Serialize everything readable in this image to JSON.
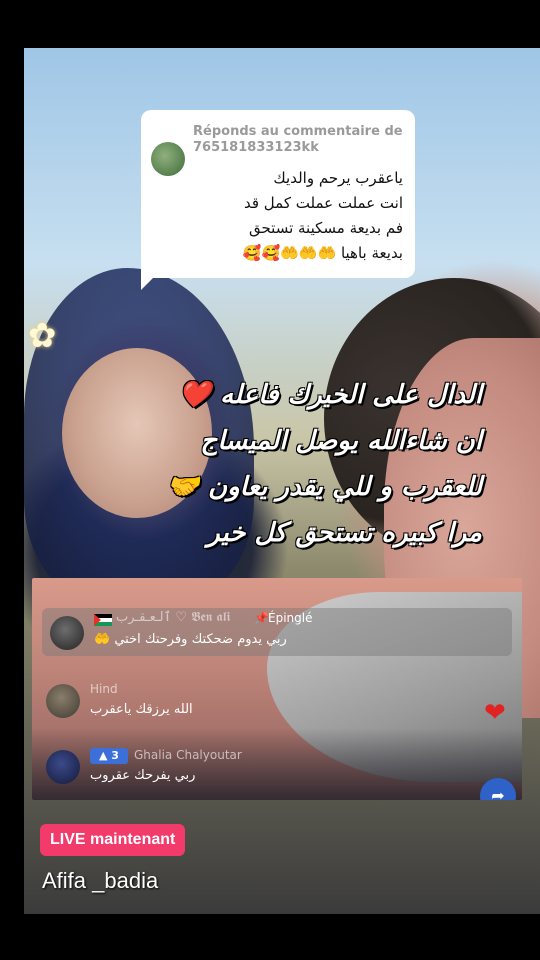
{
  "comment": {
    "reply_to": "Réponds au commentaire de 765181833123kk",
    "lines": [
      "ياعقرب يرحم والديك",
      "انت عملت عملت كمل قد",
      "فم بديعة مسكينة تستحق",
      "بديعة باهيا 🤲🤲🤲🥰🥰"
    ]
  },
  "caption": {
    "lines": [
      "الدال على الخيرك فاعله ❤️",
      "ان شاءالله يوصل الميساج",
      "للعقرب و للي يقدر يعاون 🤝",
      "مرا كبيره تستحق كل خير"
    ]
  },
  "live_panel": {
    "pinned": {
      "name": "𝕭𝖊𝖓 𝖆𝖑𝖎 ♡ ٱلـعـقـرب",
      "pinned_label": "Épinglé",
      "message": "ربي يدوم ضحكتك وفرحتك اختي 🤲"
    },
    "comments": [
      {
        "name": "Hind",
        "message": "الله يرزقك ياعقرب"
      },
      {
        "badge": "▲ 3",
        "name": "Ghalia Chalyoutar",
        "message": "ربي يفرحك عقروب"
      }
    ]
  },
  "live_badge": "LIVE maintenant",
  "host_name": "Afifa _badia",
  "icons": {
    "pin": "pin-icon",
    "heart": "heart-icon",
    "share": "share-icon",
    "flower": "flower-icon"
  },
  "colors": {
    "live_badge": "#f23a6b",
    "level_badge": "#3d6fd9",
    "heart": "#e02424"
  }
}
